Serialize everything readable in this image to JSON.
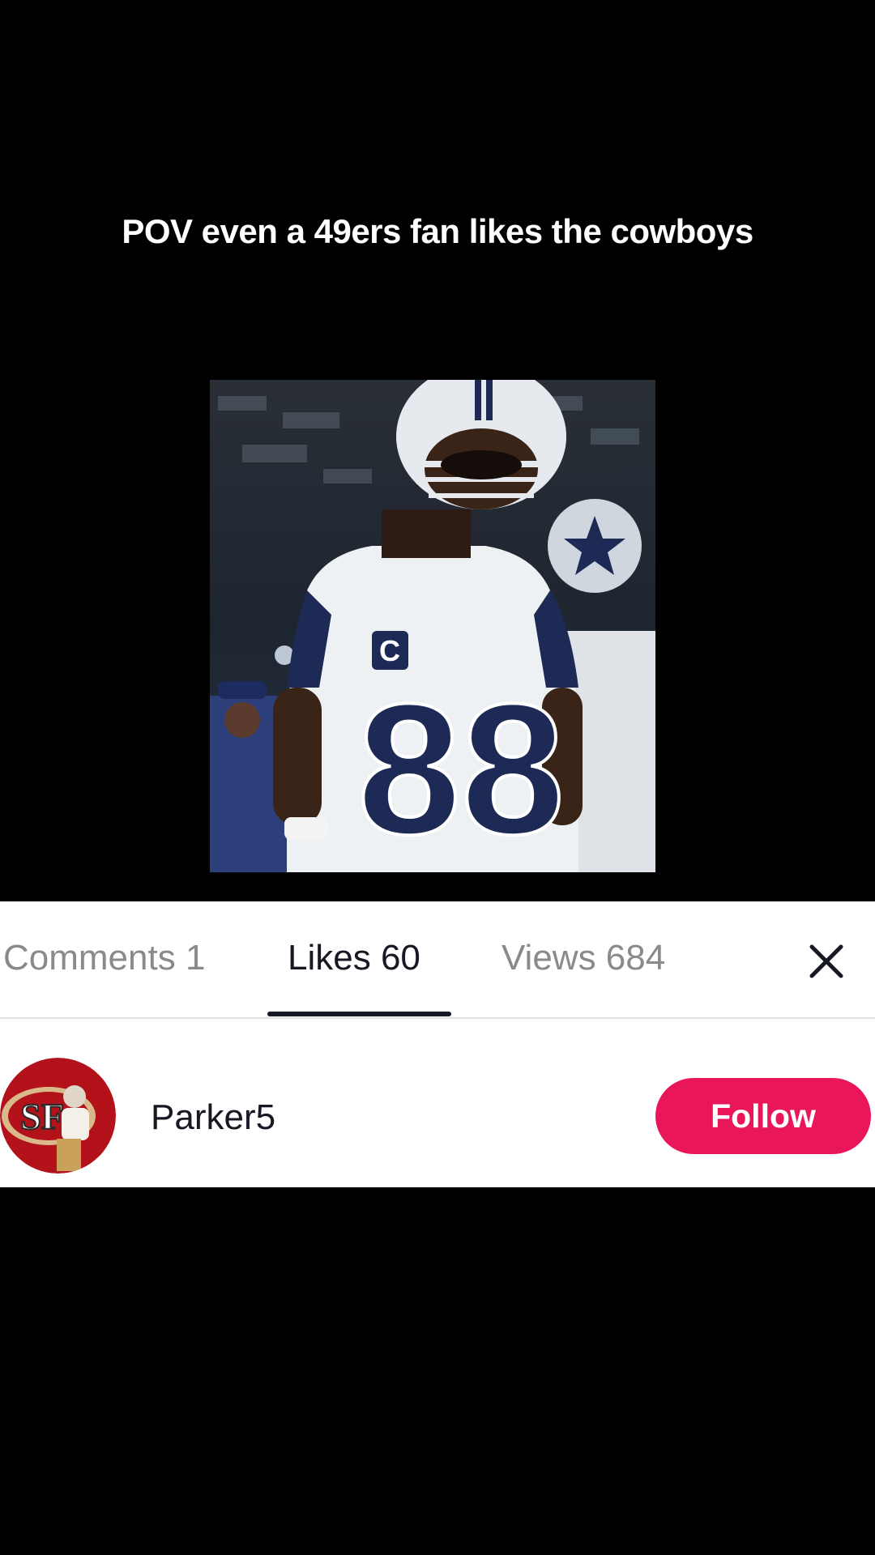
{
  "post": {
    "caption": "POV even a 49ers fan likes the cowboys"
  },
  "tabs": [
    {
      "label": "Comments 1",
      "active": false
    },
    {
      "label": "Likes 60",
      "active": true
    },
    {
      "label": "Views 684",
      "active": false
    }
  ],
  "likes_list": [
    {
      "username": "Parker5",
      "follow_label": "Follow"
    }
  ],
  "colors": {
    "follow_button": "#e9175a",
    "active_tab": "#161823",
    "inactive_tab": "#8a8a8a"
  },
  "icons": {
    "close": "close-icon"
  }
}
